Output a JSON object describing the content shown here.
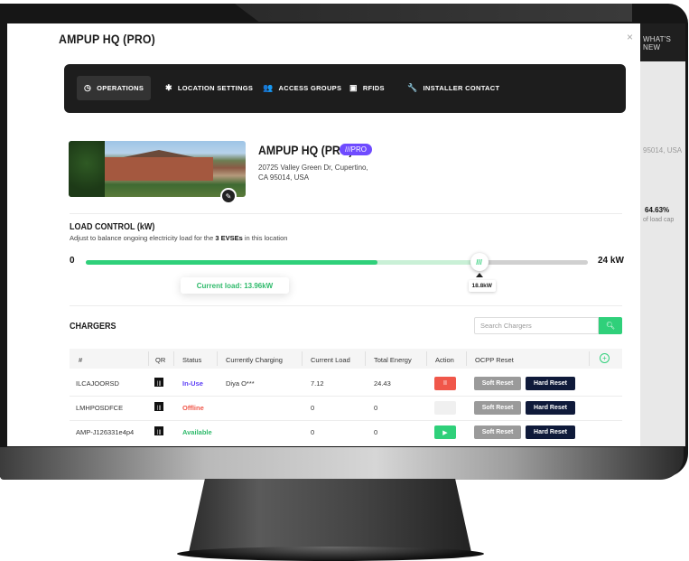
{
  "background": {
    "whats_new": "WHAT'S NEW",
    "zip_fragment": "95014, USA",
    "percent": "64.63%",
    "load_cap_fragment": "of load cap"
  },
  "modal": {
    "title": "AMPUP HQ (PRO)",
    "close": "×"
  },
  "nav": {
    "items": [
      {
        "label": "OPERATIONS",
        "icon": "gauge-icon",
        "glyph": "◷",
        "active": true
      },
      {
        "label": "LOCATION SETTINGS",
        "icon": "gear-icon",
        "glyph": "✱",
        "active": false
      },
      {
        "label": "ACCESS GROUPS",
        "icon": "users-icon",
        "glyph": "👥",
        "active": false
      },
      {
        "label": "RFIDS",
        "icon": "card-icon",
        "glyph": "▣",
        "active": false
      },
      {
        "label": "INSTALLER CONTACT",
        "icon": "wrench-icon",
        "glyph": "🔧",
        "active": false
      }
    ]
  },
  "location": {
    "name": "AMPUP HQ (PRO)",
    "badge": "///PRO",
    "address_line1": "20725 Valley Green Dr, Cupertino,",
    "address_line2": "CA 95014, USA"
  },
  "load_control": {
    "title": "LOAD CONTROL (kW)",
    "subtitle_pre": "Adjust to balance ongoing electricity load for the ",
    "subtitle_bold": "3 EVSEs",
    "subtitle_post": " in this location",
    "min_label": "0",
    "max_label": "24 kW",
    "max_value": 24,
    "current_load_label": "Current load: 13.96kW",
    "current_load_value": 13.96,
    "cap_label": "18.8kW",
    "cap_value": 18.8,
    "knob_glyph": "///"
  },
  "chargers": {
    "title": "CHARGERS",
    "search_placeholder": "Search Chargers",
    "columns": [
      "#",
      "QR",
      "Status",
      "Currently Charging",
      "Current Load",
      "Total Energy",
      "Action",
      "OCPP Reset"
    ],
    "soft_reset_label": "Soft Reset",
    "hard_reset_label": "Hard Reset",
    "rows": [
      {
        "id": "ILCAJOORSD",
        "status": "In-Use",
        "status_color": "#5b3df5",
        "charging": "Diya O***",
        "load": "7.12",
        "energy": "24.43",
        "action": "pause",
        "action_glyph": "II",
        "action_color": "#f0574a"
      },
      {
        "id": "LMHPOSDFCE",
        "status": "Offline",
        "status_color": "#f0574a",
        "charging": "",
        "load": "0",
        "energy": "0",
        "action": "disabled",
        "action_glyph": "",
        "action_color": "#f0f0f0"
      },
      {
        "id": "AMP-J126331e4p4",
        "status": "Available",
        "status_color": "#2fba6b",
        "charging": "",
        "load": "0",
        "energy": "0",
        "action": "play",
        "action_glyph": "▶",
        "action_color": "#2fd07a"
      }
    ]
  }
}
